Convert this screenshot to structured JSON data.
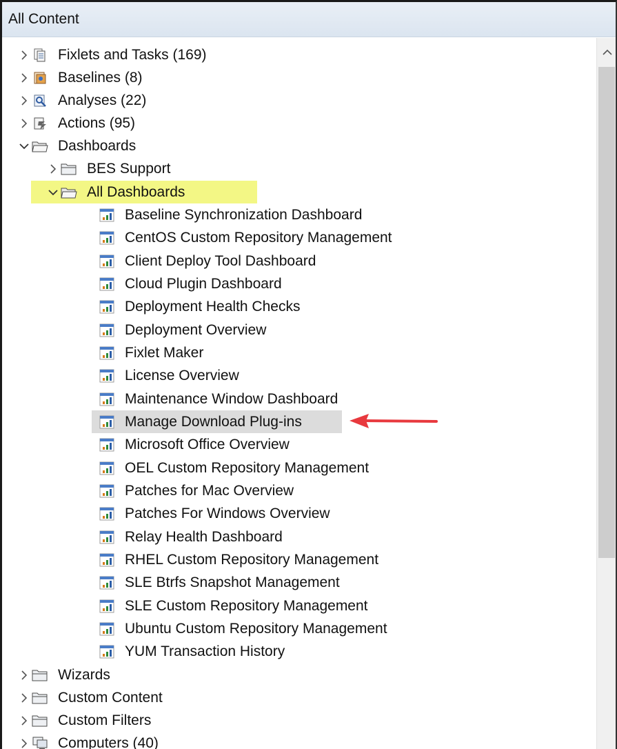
{
  "panel": {
    "title": "All Content"
  },
  "colors": {
    "highlight": "#f3f785",
    "selected": "#dcdcdc",
    "arrow": "#e8393e",
    "header": "#dbe5f0"
  },
  "tree": {
    "fixlets": {
      "label": "Fixlets and Tasks (169)",
      "icon": "fixlets-icon"
    },
    "baselines": {
      "label": "Baselines (8)",
      "icon": "baselines-icon"
    },
    "analyses": {
      "label": "Analyses (22)",
      "icon": "analyses-icon"
    },
    "actions": {
      "label": "Actions (95)",
      "icon": "actions-icon"
    },
    "dashboards": {
      "label": "Dashboards",
      "icon": "folder-open-icon"
    },
    "bes_support": {
      "label": "BES Support",
      "icon": "folder-icon"
    },
    "all_dashboards": {
      "label": "All Dashboards",
      "icon": "folder-open-icon"
    },
    "dashboard_items": [
      "Baseline Synchronization Dashboard",
      "CentOS Custom Repository Management",
      "Client Deploy Tool Dashboard",
      "Cloud Plugin Dashboard",
      "Deployment Health Checks",
      "Deployment Overview",
      "Fixlet Maker",
      "License Overview",
      "Maintenance Window Dashboard",
      "Manage Download Plug-ins",
      "Microsoft Office Overview",
      "OEL Custom Repository Management",
      "Patches for Mac Overview",
      "Patches For Windows Overview",
      "Relay Health Dashboard",
      "RHEL Custom Repository Management",
      "SLE Btrfs Snapshot Management",
      "SLE Custom Repository Management",
      "Ubuntu Custom Repository Management",
      "YUM Transaction History"
    ],
    "selected_item": "Manage Download Plug-ins",
    "wizards": {
      "label": "Wizards",
      "icon": "folder-icon"
    },
    "custom_content": {
      "label": "Custom Content",
      "icon": "folder-icon"
    },
    "custom_filters": {
      "label": "Custom Filters",
      "icon": "folder-icon"
    },
    "computers": {
      "label": "Computers (40)",
      "icon": "computers-icon"
    }
  }
}
